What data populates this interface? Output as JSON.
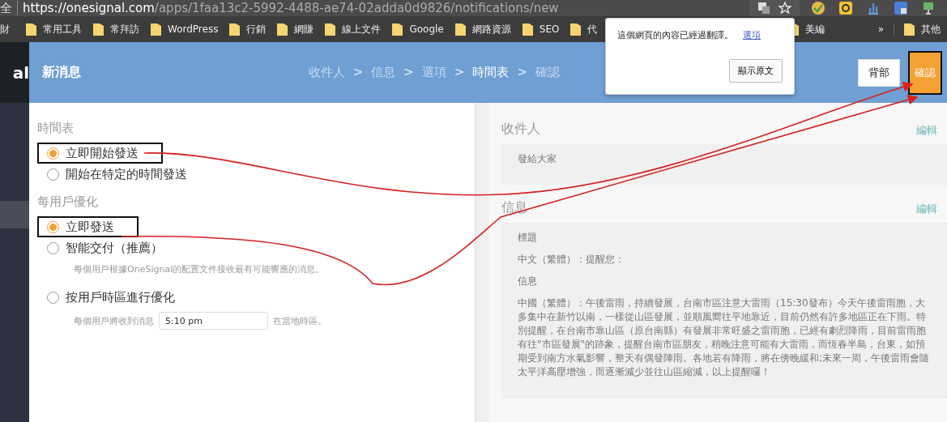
{
  "browser": {
    "address_prefix": "全",
    "url_host": "https://onesignal.com",
    "url_path": "/apps/1faa13c2-5992-4488-ae74-02adda0d9826/notifications/new"
  },
  "bookmark_cut": "財",
  "bookmarks": [
    "常用工具",
    "常拜訪",
    "WordPress",
    "行銷",
    "網賺",
    "線上文件",
    "Google",
    "網路資源",
    "SEO",
    "代"
  ],
  "bookmarks_right": [
    "美編"
  ],
  "bookmarks_more": "»",
  "other_bookmarks": "其他",
  "translate_popup": {
    "message": "這個網頁的內容已經過翻譯。",
    "link": "選項",
    "button": "顯示原文"
  },
  "sidebar": {
    "logo": "al"
  },
  "header": {
    "title": "新消息",
    "steps": [
      {
        "label": "收件人",
        "selected": false
      },
      {
        "separator": ">",
        "label": "信息",
        "selected": false
      },
      {
        "separator": ">",
        "label": "選項",
        "selected": false
      },
      {
        "separator": ">",
        "label": "時間表",
        "selected": true
      },
      {
        "separator": ">",
        "label": "確認",
        "selected": false
      }
    ],
    "back_button": "背部",
    "confirm_button": "確認"
  },
  "sections": [
    {
      "title": "時間表",
      "options": [
        {
          "label": "立即開始發送",
          "selected": true,
          "highlighted": true
        },
        {
          "label": "開始在特定的時間發送",
          "selected": false,
          "highlighted": false
        }
      ]
    },
    {
      "title": "每用戶優化",
      "options": [
        {
          "label": "立即發送",
          "selected": true,
          "highlighted": true
        },
        {
          "label": "智能交付（推薦）",
          "selected": false,
          "highlighted": false,
          "description": "每個用戶根據OneSignal的配置文件接收最有可能響應的消息。"
        },
        {
          "label": "按用戶時區進行優化",
          "selected": false,
          "highlighted": false,
          "description_before": "每個用戶將收到消息",
          "time_field": {
            "value": "5:10 pm"
          },
          "description_after": "在當地時區。"
        }
      ]
    }
  ],
  "summary": [
    {
      "title": "收件人",
      "edit": "編輯",
      "lines": [
        "發給大家"
      ]
    },
    {
      "title": "信息",
      "edit": "編輯",
      "lines": [
        "標題",
        "中文（繁體）：提醒您：",
        "信息",
        "中國（繁體）：午後雷雨，持續發展，台南市區注意大雷雨（15:30發布）今天午後雷雨胞，大多集中在新竹以南，一樣從山區發展，並順風嚮往平地靠近，目前仍然有許多地區正在下雨。特別提醒，在台南市靠山區（原台南縣）有發展非常旺盛之雷雨胞，已經有劇烈降雨，目前雷雨胞有往\"市區發展\"的跡象，提醒台南市區朋友，稍晚注意可能有大雷雨，而恆春半島，台東，如預期受到南方水氣影響，整天有偶發陣雨。各地若有降雨，將在傍晚緩和;未來一周，午後雷雨會隨太平洋高壓增強，而逐漸減少並往山區縮減，以上提醒囉！"
      ]
    }
  ]
}
